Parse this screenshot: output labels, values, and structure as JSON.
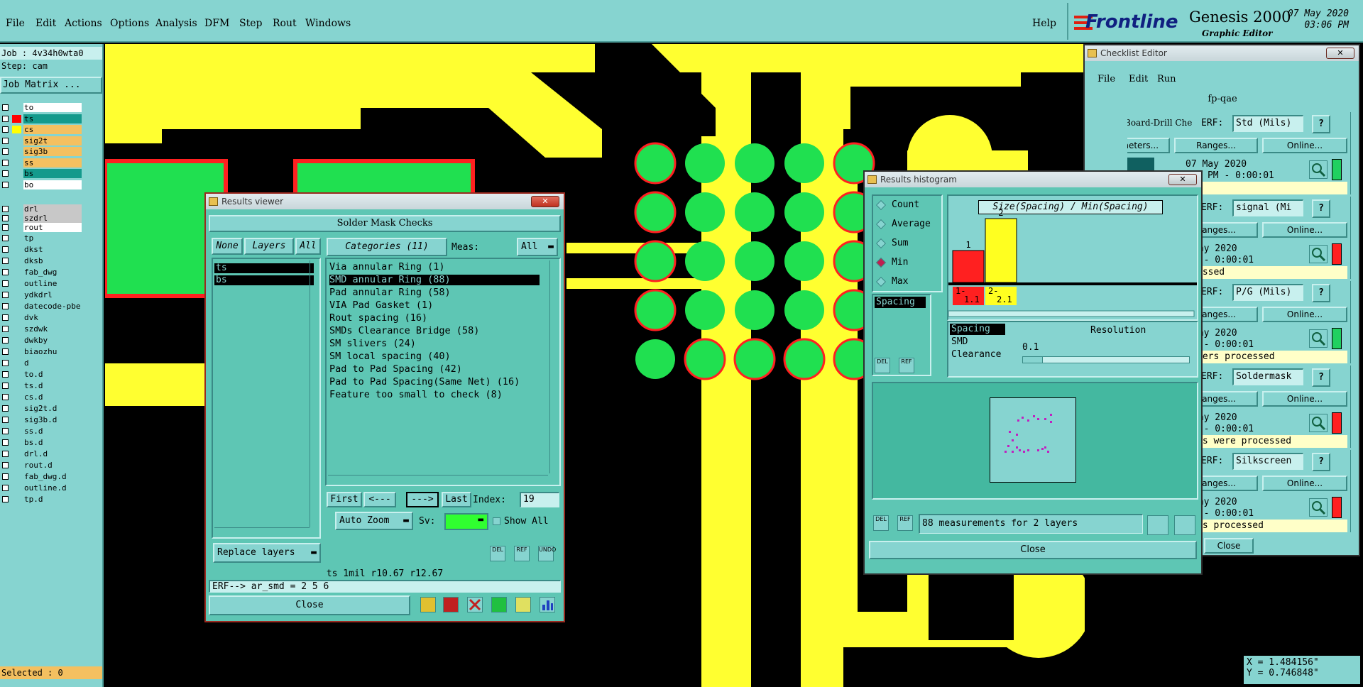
{
  "menubar": {
    "items": [
      "File",
      "Edit",
      "Actions",
      "Options",
      "Analysis",
      "DFM",
      "Step",
      "Rout",
      "Windows"
    ],
    "help": "Help",
    "brand": "Frontline",
    "product": "Genesis 2000",
    "subtitle": "Graphic Editor",
    "date": "07 May 2020",
    "time": "03:06 PM"
  },
  "left": {
    "job": "Job : 4v34h0wta0",
    "step": "Step: cam",
    "matrix_button": "Job Matrix ...",
    "selected": "Selected : 0",
    "layers_group1": [
      {
        "name": "to",
        "color": "#ffffff",
        "swatch": ""
      },
      {
        "name": "ts",
        "color": "#149a8c",
        "swatch": "#ff0000"
      },
      {
        "name": "cs",
        "color": "#f4c060",
        "swatch": "#ffff00"
      },
      {
        "name": "sig2t",
        "color": "#f4c060",
        "swatch": ""
      },
      {
        "name": "sig3b",
        "color": "#f4c060",
        "swatch": ""
      },
      {
        "name": "ss",
        "color": "#f4c060",
        "swatch": ""
      },
      {
        "name": "bs",
        "color": "#149a8c",
        "swatch": ""
      },
      {
        "name": "bo",
        "color": "#ffffff",
        "swatch": ""
      }
    ],
    "layers_group2": [
      {
        "name": "drl",
        "color": "#c8c8c8"
      },
      {
        "name": "szdrl",
        "color": "#c8c8c8"
      },
      {
        "name": "rout",
        "color": "#ffffff"
      }
    ],
    "layers_group3": [
      "tp",
      "dkst",
      "dksb",
      "fab_dwg",
      "outline",
      "ydkdrl",
      "datecode-pbe",
      "dvk",
      "szdwk",
      "dwkby",
      "biaozhu",
      "d",
      "to.d",
      "ts.d",
      "cs.d",
      "sig2t.d",
      "sig3b.d",
      "ss.d",
      "bs.d",
      "drl.d",
      "rout.d",
      "fab_dwg.d",
      "outline.d",
      "tp.d"
    ]
  },
  "results_viewer": {
    "title": "Results viewer",
    "header": "Solder Mask Checks",
    "btn_none": "None",
    "btn_layers": "Layers",
    "btn_all": "All",
    "layers": [
      "ts",
      "bs"
    ],
    "categories_label": "Categories (11)",
    "meas_label": "Meas:",
    "meas_value": "All",
    "categories": [
      "Via annular Ring (1)",
      "SMD annular Ring (88)",
      "Pad annular Ring (58)",
      "VIA Pad Gasket (1)",
      "Rout spacing (16)",
      "SMDs Clearance Bridge (58)",
      "SM slivers (24)",
      "SM local spacing (40)",
      "Pad to Pad Spacing (42)",
      "Pad to Pad Spacing(Same Net) (16)",
      "Feature too small to check (8)"
    ],
    "selected_category": 1,
    "btn_first": "First",
    "btn_prev": "<---",
    "btn_next": "--->",
    "btn_last": "Last",
    "index_label": "Index:",
    "index_value": "19",
    "auto_zoom": "Auto Zoom",
    "sv_label": "Sv:",
    "show_all": "Show All",
    "replace_layers": "Replace layers",
    "del": "DEL",
    "ref": "REF",
    "undo": "UNDO",
    "status": "ts 1mil  r10.67  r12.67",
    "erf": "ERF--> ar_smd = 2 5 6",
    "close": "Close"
  },
  "histogram": {
    "title": "Results histogram",
    "options": [
      "Count",
      "Average",
      "Sum",
      "Min",
      "Max"
    ],
    "selected_option": "Min",
    "spacing_item": "Spacing",
    "chart_title": "Size(Spacing) / Min(Spacing)",
    "resolution_label": "Resolution",
    "resolution_value": "0.1",
    "categories_list": [
      "Spacing",
      "SMD",
      "Clearance"
    ],
    "summary": "88 measurements for 2 layers",
    "close": "Close",
    "del": "DEL",
    "ref": "REF"
  },
  "chart_data": {
    "type": "bar",
    "title": "Size(Spacing) / Min(Spacing)",
    "categories": [
      "1- 1.1",
      "2- 2.1"
    ],
    "values": [
      1,
      2
    ],
    "colors": [
      "#ff2020",
      "#ffff20"
    ],
    "ylim": [
      0,
      2
    ]
  },
  "checklist": {
    "title": "Checklist Editor",
    "menu": [
      "File",
      "Edit",
      "Run"
    ],
    "name": "fp-qae",
    "board_drill": "Board-Drill Che",
    "erf_label": "ERF:",
    "rows": [
      {
        "erf": "Std (Mils)",
        "date": "07 May 2020",
        "time": "03:33 PM - 0:00:01",
        "status": "",
        "bar": "#20d060"
      },
      {
        "erf": "signal (Mi",
        "date": "May 2020",
        "time": "M - 0:00:01",
        "status": "essed",
        "bar": "#ff2020"
      },
      {
        "erf": "P/G (Mils)",
        "date": "May 2020",
        "time": "M - 0:00:01",
        "status": "yers processed",
        "bar": "#20d060"
      },
      {
        "erf": "Soldermask",
        "date": "May 2020",
        "time": "M - 0:00:01",
        "status": "rs were processed",
        "bar": "#ff2020"
      },
      {
        "erf": "Silkscreen",
        "date": "May 2020",
        "time": "M - 0:00:01",
        "status": "rs processed",
        "bar": "#ff2020"
      }
    ],
    "parameters": "Parameters...",
    "ranges": "Ranges...",
    "online": "Online...",
    "help": "?",
    "close": "Close"
  },
  "coords": {
    "x": "X = 1.484156\"",
    "y": "Y = 0.746848\""
  }
}
